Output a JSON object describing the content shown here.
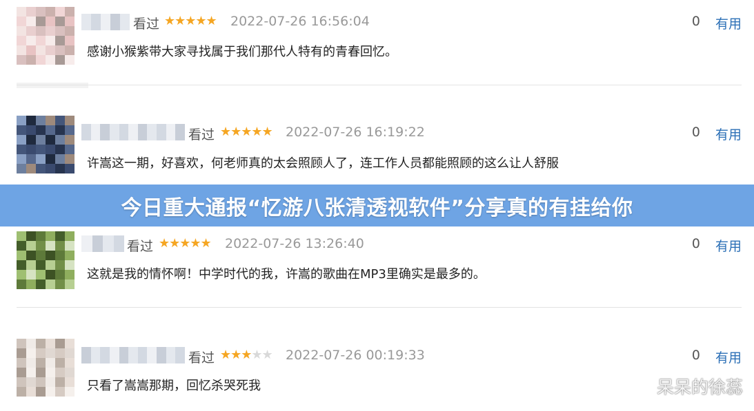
{
  "banner": {
    "text": "今日重大通报“忆游八张清透视软件”分享真的有挂给你"
  },
  "watermark": "呆呆的徐蕊",
  "reviews": [
    {
      "status": "看过",
      "rating": 5,
      "stars_display": "★★★★★",
      "stars_empty": "",
      "date": "2022-07-26 16:56:04",
      "useful_count": "0",
      "useful_label": "有用",
      "text": "感谢小猴紫带大家寻找属于我们那代人特有的青春回忆。"
    },
    {
      "status": "看过",
      "rating": 5,
      "stars_display": "★★★★★",
      "stars_empty": "",
      "date": "2022-07-26 16:19:22",
      "useful_count": "0",
      "useful_label": "有用",
      "text": "许嵩这一期，好喜欢，何老师真的太会照顾人了，连工作人员都能照顾的这么让人舒服"
    },
    {
      "status": "看过",
      "rating": 5,
      "stars_display": "★★★★★",
      "stars_empty": "",
      "date": "2022-07-26 13:26:40",
      "useful_count": "0",
      "useful_label": "有用",
      "text": "这就是我的情怀啊！中学时代的我，许嵩的歌曲在MP3里确实是最多的。"
    },
    {
      "status": "看过",
      "rating": 3,
      "stars_display": "★★★",
      "stars_empty": "★★",
      "date": "2022-07-26 00:19:33",
      "useful_count": "0",
      "useful_label": "有用",
      "text": "只看了嵩嵩那期，回忆杀哭死我"
    }
  ],
  "colors": {
    "accent": "#2b6fb6",
    "star": "#f5a623",
    "banner": "#6ea4e4"
  }
}
